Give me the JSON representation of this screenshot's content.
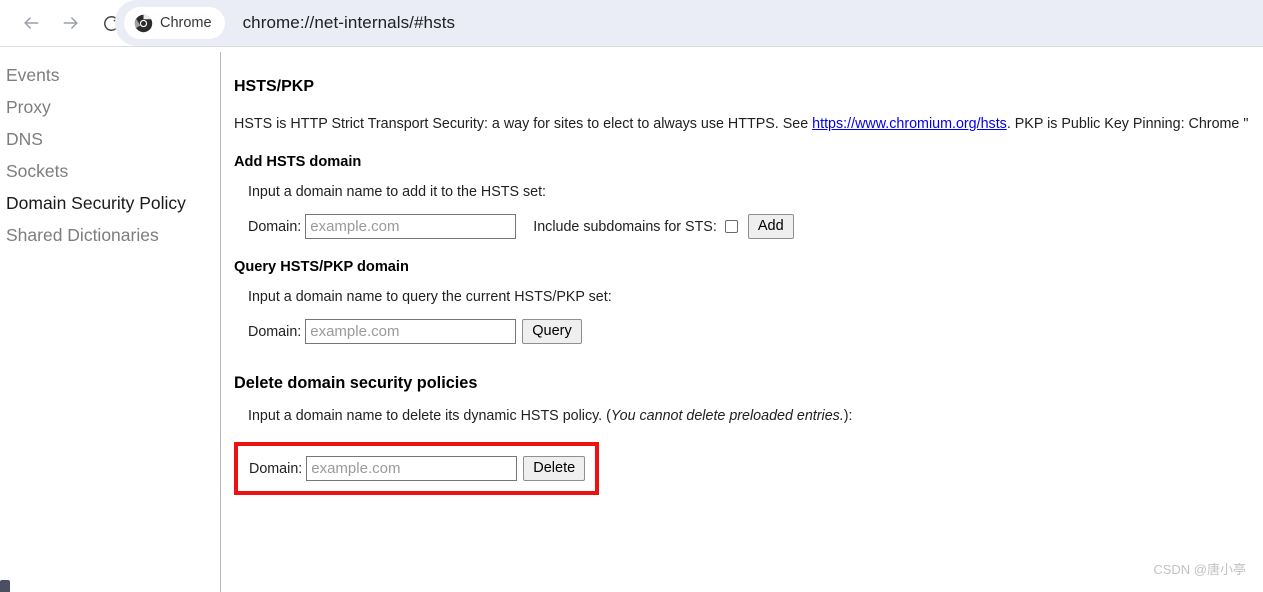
{
  "browser": {
    "back_icon": "back-arrow-icon",
    "forward_icon": "forward-arrow-icon",
    "reload_icon": "reload-icon",
    "chrome_chip_label": "Chrome",
    "url": "chrome://net-internals/#hsts",
    "omnibox_bg": "#eaecf6"
  },
  "sidebar": {
    "items": [
      {
        "label": "Events",
        "active": false
      },
      {
        "label": "Proxy",
        "active": false
      },
      {
        "label": "DNS",
        "active": false
      },
      {
        "label": "Sockets",
        "active": false
      },
      {
        "label": "Domain Security Policy",
        "active": true
      },
      {
        "label": "Shared Dictionaries",
        "active": false
      }
    ]
  },
  "main": {
    "title": "HSTS/PKP",
    "intro_before_link": "HSTS is HTTP Strict Transport Security: a way for sites to elect to always use HTTPS. See ",
    "intro_link": "https://www.chromium.org/hsts",
    "intro_after_link": ". PKP is Public Key Pinning: Chrome \"",
    "add": {
      "heading": "Add HSTS domain",
      "hint": "Input a domain name to add it to the HSTS set:",
      "domain_label": "Domain:",
      "domain_value": "",
      "domain_placeholder": "example.com",
      "checkbox_label": "Include subdomains for STS:",
      "checkbox_checked": false,
      "button_label": "Add"
    },
    "query": {
      "heading": "Query HSTS/PKP domain",
      "hint": "Input a domain name to query the current HSTS/PKP set:",
      "domain_label": "Domain:",
      "domain_value": "",
      "domain_placeholder": "example.com",
      "button_label": "Query"
    },
    "delete": {
      "heading": "Delete domain security policies",
      "hint_prefix": "Input a domain name to delete its dynamic HSTS policy. (",
      "hint_italic": "You cannot delete preloaded entries.",
      "hint_suffix": "):",
      "domain_label": "Domain:",
      "domain_value": "",
      "domain_placeholder": "example.com",
      "button_label": "Delete",
      "highlight_color": "#ee1111"
    }
  },
  "watermark": "CSDN @唐小亭"
}
